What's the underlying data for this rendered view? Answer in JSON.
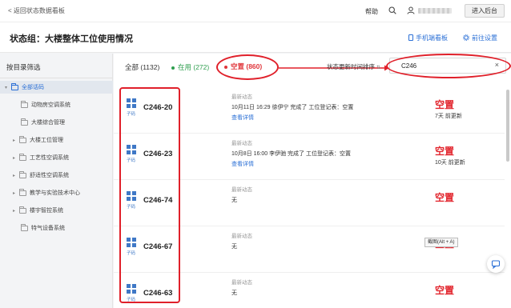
{
  "topbar": {
    "back_label": "< 返回状态数据看板",
    "help_label": "帮助",
    "enter_button": "进入后台"
  },
  "titlebar": {
    "title": "状态组：大楼整体工位使用情况",
    "mobile_link": "手机端看板",
    "goto_link": "前往设置"
  },
  "sidebar": {
    "title": "按目录筛选",
    "items": [
      {
        "label": "全部话码",
        "active": true,
        "expandable": true
      },
      {
        "label": "动物房空调系统",
        "active": false,
        "expandable": false
      },
      {
        "label": "大楼综合管理",
        "active": false,
        "expandable": false
      },
      {
        "label": "大楼工位管理",
        "active": false,
        "expandable": true
      },
      {
        "label": "工艺性空调系统",
        "active": false,
        "expandable": true
      },
      {
        "label": "舒适性空调系统",
        "active": false,
        "expandable": true
      },
      {
        "label": "教学与实验技术中心",
        "active": false,
        "expandable": true
      },
      {
        "label": "楼宇智控系统",
        "active": false,
        "expandable": true
      },
      {
        "label": "特气设备系统",
        "active": false,
        "expandable": false
      }
    ]
  },
  "filters": {
    "all": "全部 (1132)",
    "in_use": "在用 (272)",
    "vacant": "空置 (860)",
    "sort_label": "状态更新时间排序"
  },
  "search": {
    "value": "C246",
    "clear": "×"
  },
  "rows": [
    {
      "icon_label": "子码",
      "code": "C246-20",
      "latest_label": "最新动态",
      "latest_text": "10月11日 16:29  徐伊宁 完成了 工位登记表：空置",
      "detail": "查看详情",
      "status": "空置",
      "updated": "7天 前更新"
    },
    {
      "icon_label": "子码",
      "code": "C246-23",
      "latest_label": "最新动态",
      "latest_text": "10月8日 16:00  李伊驰 完成了 工位登记表：空置",
      "detail": "查看详情",
      "status": "空置",
      "updated": "10天 前更新"
    },
    {
      "icon_label": "子码",
      "code": "C246-74",
      "latest_label": "最新动态",
      "latest_text": "无",
      "detail": "",
      "status": "空置",
      "updated": ""
    },
    {
      "icon_label": "子码",
      "code": "C246-67",
      "latest_label": "最新动态",
      "latest_text": "无",
      "detail": "",
      "status": "空置",
      "updated": ""
    },
    {
      "icon_label": "子码",
      "code": "C246-63",
      "latest_label": "最新动态",
      "latest_text": "无",
      "detail": "",
      "status": "空置",
      "updated": ""
    }
  ],
  "tooltip": "截图(Alt + A)",
  "colors": {
    "accent_blue": "#2a6fd6",
    "vacant_red": "#e2262e",
    "in_use_green": "#2e9e4e",
    "annotation_red": "#e0202a"
  }
}
